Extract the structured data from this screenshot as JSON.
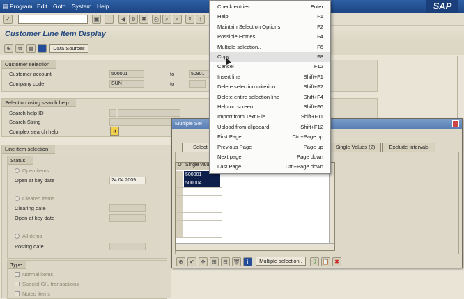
{
  "menubar": {
    "items": [
      "Program",
      "Edit",
      "Goto",
      "System",
      "Help"
    ],
    "logo": "SAP"
  },
  "title": "Customer Line Item Display",
  "apptoolbar": {
    "data_sources": "Data Sources"
  },
  "customer_selection": {
    "header": "Customer selection",
    "customer_account_label": "Customer account",
    "customer_account_value": "500001",
    "to1": "to",
    "customer_account_to": "50801",
    "company_code_label": "Company code",
    "company_code_value": "SUN",
    "to2": "to"
  },
  "search_help": {
    "header": "Selection using search help",
    "id_label": "Search help ID",
    "string_label": "Search String",
    "complex_label": "Complex search help"
  },
  "line_item": {
    "header": "Line item selection",
    "status": "Status",
    "open_items": "Open items",
    "open_at_key_date": "Open at key date",
    "open_date_value": "24.04.2009",
    "cleared_items": "Cleared items",
    "clearing_date": "Clearing date",
    "open_at_key_date2": "Open at key date",
    "all_items": "All items",
    "posting_date": "Posting date",
    "type": "Type",
    "normal_items": "Normal items",
    "special_gl": "Special G/L transactions",
    "noted_items": "Noted items"
  },
  "dialog": {
    "title": "Multiple Sel",
    "tab_select": "Select S",
    "tab_single": "Single Values (2)",
    "tab_exclude": "Exclude Intervals",
    "col_o": "O",
    "col_single": "Single valu",
    "values": [
      "500001",
      "500004"
    ],
    "multiple_selection_btn": "Multiple selection.."
  },
  "context_menu": {
    "items": [
      {
        "label": "Check entries",
        "key": "Enter"
      },
      {
        "label": "Help",
        "key": "F1"
      },
      {
        "label": "Maintain Selection Options",
        "key": "F2"
      },
      {
        "label": "Possible Entries",
        "key": "F4"
      },
      {
        "label": "Multiple selection..",
        "key": "F6"
      },
      {
        "label": "Copy",
        "key": "F8"
      },
      {
        "label": "Cancel",
        "key": "F12"
      },
      {
        "label": "Insert line",
        "key": "Shift+F1"
      },
      {
        "label": "Delete selection criterion",
        "key": "Shift+F2"
      },
      {
        "label": "Delete entire selection line",
        "key": "Shift+F4"
      },
      {
        "label": "Help on screen",
        "key": "Shift+F6"
      },
      {
        "label": "Import from Text File",
        "key": "Shift+F11"
      },
      {
        "label": "Upload from clipboard",
        "key": "Shift+F12"
      },
      {
        "label": "First Page",
        "key": "Ctrl+Page up"
      },
      {
        "label": "Previous Page",
        "key": "Page up"
      },
      {
        "label": "Next page",
        "key": "Page down"
      },
      {
        "label": "Last Page",
        "key": "Ctrl+Page down"
      }
    ]
  }
}
